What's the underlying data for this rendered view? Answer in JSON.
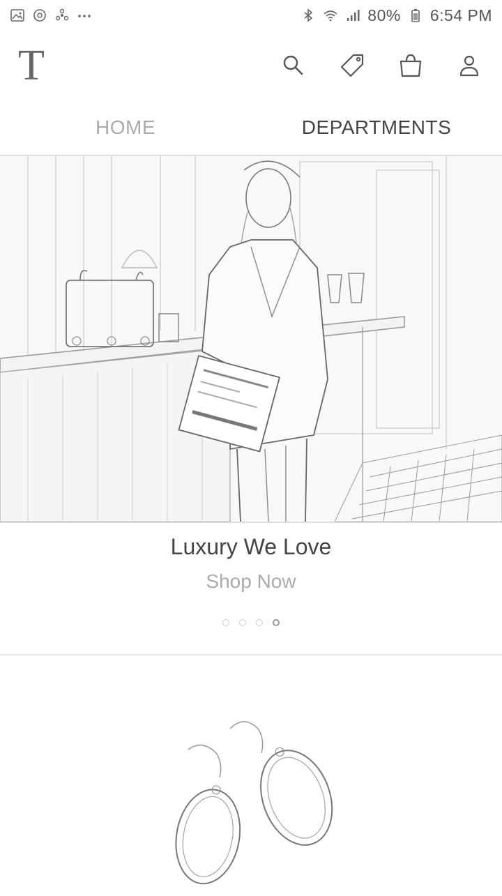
{
  "status_bar": {
    "battery": "80%",
    "time": "6:54 PM",
    "left_icons": [
      "gallery-icon",
      "sync-icon",
      "fan-icon",
      "more-dots-icon"
    ],
    "right_icons": [
      "bluetooth-icon",
      "wifi-icon",
      "signal-icon",
      "battery-icon"
    ]
  },
  "header": {
    "logo": "T",
    "icons": [
      "search-icon",
      "tag-icon",
      "shopping-bag-icon",
      "profile-icon"
    ]
  },
  "tabs": [
    {
      "label": "HOME",
      "active": false
    },
    {
      "label": "DEPARTMENTS",
      "active": true
    }
  ],
  "hero": {
    "title": "Luxury We Love",
    "cta": "Shop Now",
    "slides": 4,
    "active_slide": 4
  }
}
